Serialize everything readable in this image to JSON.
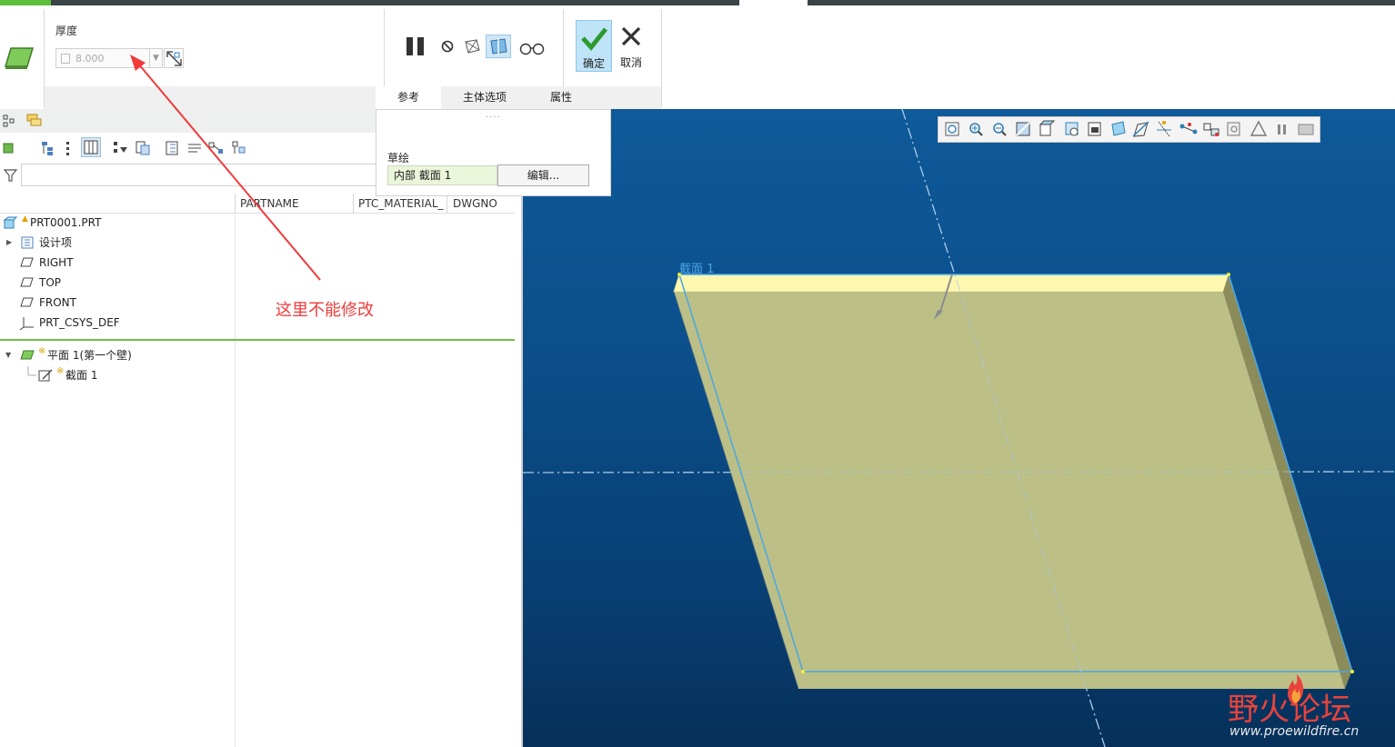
{
  "dashboard": {
    "thickness_label": "厚度",
    "thickness_value": "8.000",
    "ok_label": "确定",
    "cancel_label": "取消",
    "tabs": [
      "参考",
      "主体选项",
      "属性"
    ]
  },
  "ref_panel": {
    "grip": "....",
    "sketch_label": "草绘",
    "sketch_value": "内部 截面 1",
    "edit_button": "编辑..."
  },
  "model_tree": {
    "columns": [
      "PARTNAME",
      "PTC_MATERIAL_",
      "DWGNO"
    ],
    "items": [
      {
        "label": "PRT0001.PRT",
        "icon": "part-icon"
      },
      {
        "label": "设计项",
        "icon": "design-items-icon"
      },
      {
        "label": "RIGHT",
        "icon": "datum-plane-icon"
      },
      {
        "label": "TOP",
        "icon": "datum-plane-icon"
      },
      {
        "label": "FRONT",
        "icon": "datum-plane-icon"
      },
      {
        "label": "PRT_CSYS_DEF",
        "icon": "csys-icon"
      }
    ],
    "features": [
      {
        "label": "平面 1(第一个壁)",
        "icon": "planar-wall-icon"
      },
      {
        "label": "截面 1",
        "icon": "sketch-icon"
      }
    ]
  },
  "annotation": "这里不能修改",
  "viewport": {
    "section_label": "截面 1"
  },
  "watermark": {
    "brand": "野火论坛",
    "url": "www.proewildfire.cn"
  },
  "colors": {
    "accent_green": "#5cbf3c",
    "annotation_red": "#f03a3a",
    "viewport_blue": "#0b4e8a",
    "plate_face": "#bcbf86",
    "plate_top_edge": "#fdf7b0"
  }
}
